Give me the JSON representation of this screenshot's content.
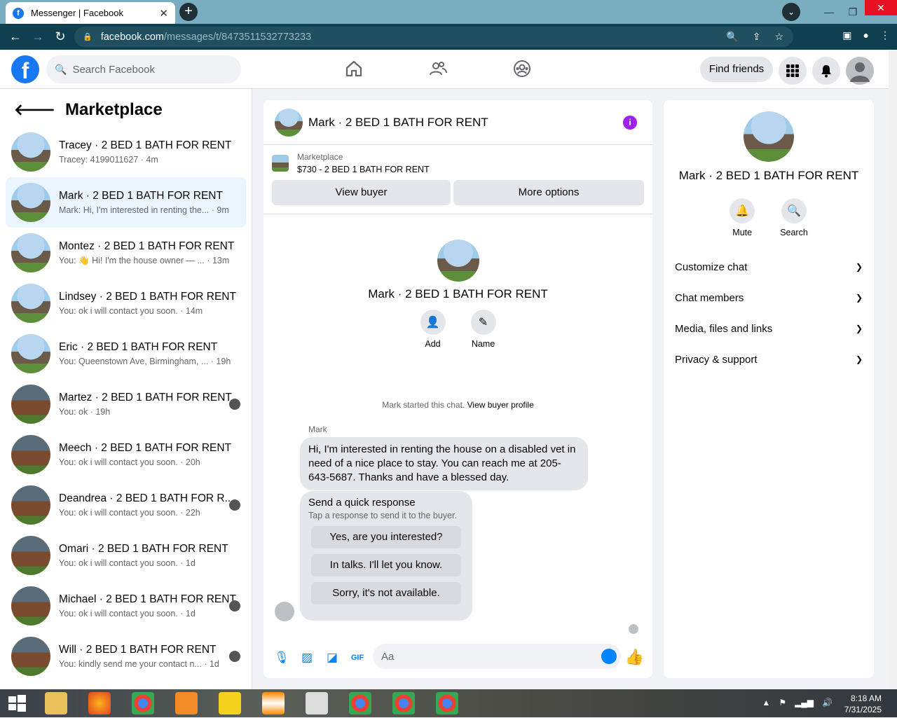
{
  "browser": {
    "tab_title": "Messenger | Facebook",
    "url_host": "facebook.com",
    "url_path": "/messages/t/8473511532773233"
  },
  "fbnav": {
    "search_placeholder": "Search Facebook",
    "find_friends": "Find friends"
  },
  "sidebar": {
    "title": "Marketplace",
    "conversations": [
      {
        "name": "Tracey · 2 BED 1 BATH FOR RENT",
        "preview": "Tracey: 4199011627 · 4m"
      },
      {
        "name": "Mark · 2 BED 1 BATH FOR RENT",
        "preview": "Mark: Hi, I'm interested in renting the... · 9m"
      },
      {
        "name": "Montez · 2 BED 1 BATH FOR RENT",
        "preview": "You: 👋 Hi! I'm the house owner — ... · 13m"
      },
      {
        "name": "Lindsey · 2 BED 1 BATH FOR RENT",
        "preview": "You: ok i will contact you soon. · 14m"
      },
      {
        "name": "Eric · 2 BED 1 BATH FOR RENT",
        "preview": "You: Queenstown Ave, Birmingham, ... · 19h"
      },
      {
        "name": "Martez · 2 BED 1 BATH FOR RENT",
        "preview": "You: ok · 19h"
      },
      {
        "name": "Meech · 2 BED 1 BATH FOR RENT",
        "preview": "You: ok i will contact you soon. · 20h"
      },
      {
        "name": "Deandrea · 2 BED 1 BATH FOR R...",
        "preview": "You: ok i will contact you soon. · 22h"
      },
      {
        "name": "Omari · 2 BED 1 BATH FOR RENT",
        "preview": "You: ok i will contact you soon. · 1d"
      },
      {
        "name": "Michael · 2 BED 1 BATH FOR RENT",
        "preview": "You: ok i will contact you soon. · 1d"
      },
      {
        "name": "Will · 2 BED 1 BATH FOR RENT",
        "preview": "You: kindly send me your contact n... · 1d"
      }
    ]
  },
  "chat": {
    "title": "Mark · 2 BED 1 BATH FOR RENT",
    "listing_label": "Marketplace",
    "listing_price": "$730 - 2 BED 1 BATH FOR RENT",
    "view_buyer": "View buyer",
    "more_options": "More options",
    "profile_name": "Mark · 2 BED 1 BATH FOR RENT",
    "add_label": "Add",
    "name_label": "Name",
    "started_text": "Mark started this chat.",
    "view_buyer_profile": "View buyer profile",
    "sender": "Mark",
    "message": "Hi, I'm interested in renting the house on a disabled vet in need of a nice place to stay. You can reach me at 205-643-5687. Thanks and have a blessed day.",
    "quick_title": "Send a quick response",
    "quick_sub": "Tap a response to send it to the buyer.",
    "quick_1": "Yes, are you interested?",
    "quick_2": "In talks. I'll let you know.",
    "quick_3": "Sorry, it's not available.",
    "input_placeholder": "Aa"
  },
  "details": {
    "name": "Mark · 2 BED 1 BATH FOR RENT",
    "mute": "Mute",
    "search": "Search",
    "sections": [
      "Customize chat",
      "Chat members",
      "Media, files and links",
      "Privacy & support"
    ]
  },
  "taskbar": {
    "time": "8:18 AM",
    "date": "7/31/2025"
  }
}
